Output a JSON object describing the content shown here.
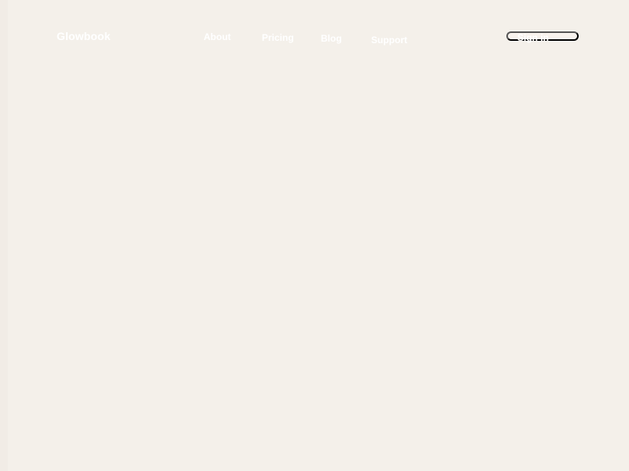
{
  "header": {
    "brand": "Glowbook",
    "nav": {
      "about": "About",
      "pricing": "Pricing",
      "blog": "Blog",
      "support": "Support"
    },
    "signin_label": "Sign in"
  },
  "colors": {
    "page_background": "#f4f0ea",
    "left_strip": "#f1ece6",
    "text": "#ffffff",
    "button_background": "#f7f2ed"
  }
}
